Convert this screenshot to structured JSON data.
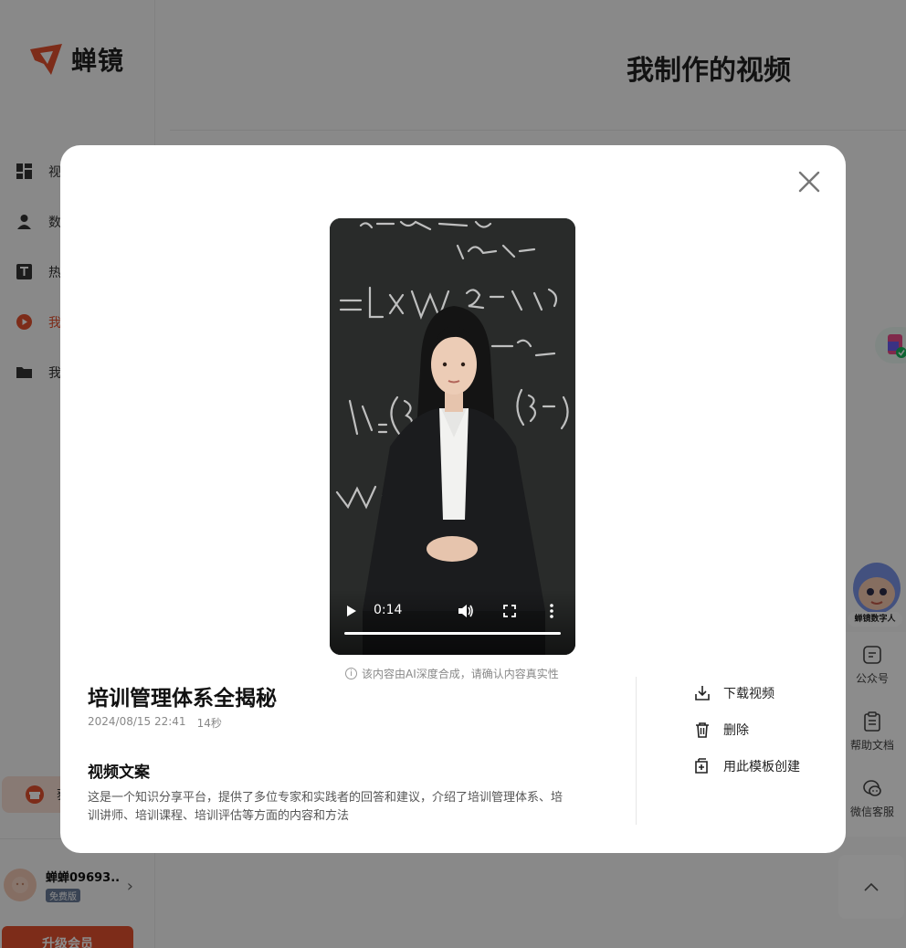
{
  "brand": {
    "name": "蝉镜",
    "accent": "#e4502f"
  },
  "sidebar": {
    "items": [
      {
        "label": "视",
        "icon": "dashboard-icon",
        "active": false
      },
      {
        "label": "数",
        "icon": "person-icon",
        "active": false
      },
      {
        "label": "热",
        "icon": "text-template-icon",
        "active": false
      },
      {
        "label": "我",
        "icon": "play-circle-icon",
        "active": true
      },
      {
        "label": "我",
        "icon": "folder-icon",
        "active": false
      }
    ],
    "promo_label": "获",
    "user_name": "蝉蝉09693...",
    "user_badge": "免费版",
    "upgrade_label": "升级会员"
  },
  "main": {
    "title": "我制作的视频"
  },
  "side_panel": {
    "mascot_label": "蝉镜数字人",
    "items": [
      {
        "label": "公众号",
        "icon": "wechat-official-icon"
      },
      {
        "label": "帮助文档",
        "icon": "clipboard-icon"
      },
      {
        "label": "微信客服",
        "icon": "chat-bubbles-icon"
      }
    ]
  },
  "modal": {
    "video": {
      "current_time": "0:14",
      "progress": 1.0
    },
    "ai_note": "该内容由AI深度合成，请确认内容真实性",
    "title": "培训管理体系全揭秘",
    "date": "2024/08/15 22:41",
    "duration": "14秒",
    "script_heading": "视频文案",
    "script_text": "这是一个知识分享平台，提供了多位专家和实践者的回答和建议，介绍了培训管理体系、培训讲师、培训课程、培训评估等方面的内容和方法",
    "actions": [
      {
        "label": "下载视频",
        "icon": "download-icon"
      },
      {
        "label": "删除",
        "icon": "trash-icon"
      },
      {
        "label": "用此模板创建",
        "icon": "copy-add-icon"
      }
    ]
  }
}
